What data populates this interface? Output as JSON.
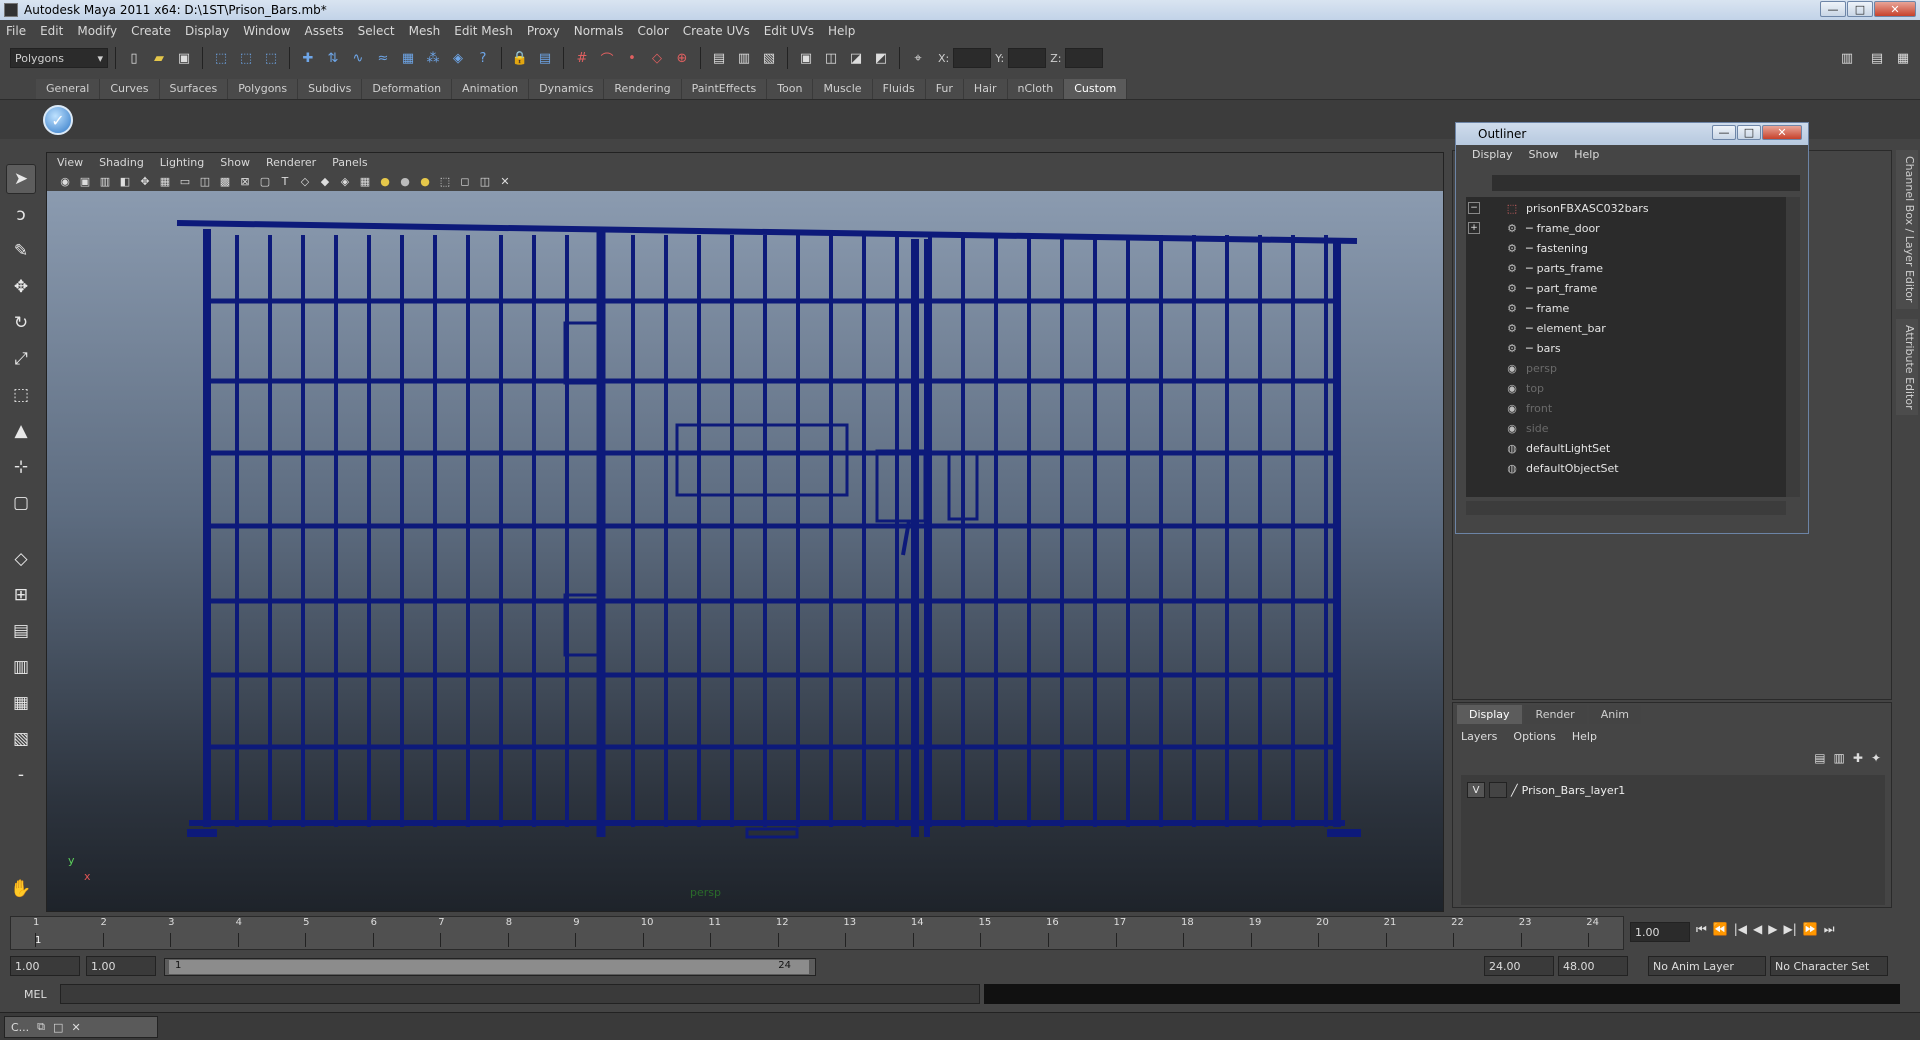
{
  "window": {
    "title": "Autodesk Maya 2011 x64: D:\\1ST\\Prison_Bars.mb*",
    "min": "—",
    "max": "□",
    "close": "✕"
  },
  "menubar": [
    "File",
    "Edit",
    "Modify",
    "Create",
    "Display",
    "Window",
    "Assets",
    "Select",
    "Mesh",
    "Edit Mesh",
    "Proxy",
    "Normals",
    "Color",
    "Create UVs",
    "Edit UVs",
    "Help"
  ],
  "status": {
    "mode": "Polygons",
    "x_label": "X:",
    "y_label": "Y:",
    "z_label": "Z:"
  },
  "shelf_tabs": [
    "General",
    "Curves",
    "Surfaces",
    "Polygons",
    "Subdivs",
    "Deformation",
    "Animation",
    "Dynamics",
    "Rendering",
    "PaintEffects",
    "Toon",
    "Muscle",
    "Fluids",
    "Fur",
    "Hair",
    "nCloth",
    "Custom"
  ],
  "shelf_active": "Custom",
  "viewport": {
    "menu": [
      "View",
      "Shading",
      "Lighting",
      "Show",
      "Renderer",
      "Panels"
    ],
    "camera_label": "persp",
    "axis_y": "y",
    "axis_x": "x",
    "wire_color": "#0d1a7a"
  },
  "outliner": {
    "title": "Outliner",
    "menu": [
      "Display",
      "Show",
      "Help"
    ],
    "items": [
      {
        "label": "prisonFBXASC032bars",
        "dim": false
      },
      {
        "label": "frame_door",
        "dim": false
      },
      {
        "label": "fastening",
        "dim": false
      },
      {
        "label": "parts_frame",
        "dim": false
      },
      {
        "label": "part_frame",
        "dim": false
      },
      {
        "label": "frame",
        "dim": false
      },
      {
        "label": "element_bar",
        "dim": false
      },
      {
        "label": "bars",
        "dim": false
      },
      {
        "label": "persp",
        "dim": true
      },
      {
        "label": "top",
        "dim": true
      },
      {
        "label": "front",
        "dim": true
      },
      {
        "label": "side",
        "dim": true
      },
      {
        "label": "defaultLightSet",
        "dim": false
      },
      {
        "label": "defaultObjectSet",
        "dim": false
      }
    ]
  },
  "side_tabs": [
    "Channel Box / Layer Editor",
    "Attribute Editor"
  ],
  "layer_editor": {
    "tabs": [
      "Display",
      "Render",
      "Anim"
    ],
    "menu": [
      "Layers",
      "Options",
      "Help"
    ],
    "layer": {
      "visible": "V",
      "name": "Prison_Bars_layer1"
    }
  },
  "timeline": {
    "ticks": [
      "1",
      "2",
      "3",
      "4",
      "5",
      "6",
      "7",
      "8",
      "9",
      "10",
      "11",
      "12",
      "13",
      "14",
      "15",
      "16",
      "17",
      "18",
      "19",
      "20",
      "21",
      "22",
      "23",
      "24"
    ],
    "current_frame": "1",
    "current_frame_field": "1.00",
    "playback": [
      "⏮",
      "⏪",
      "|◀",
      "◀",
      "▶",
      "▶|",
      "⏩",
      "⏭"
    ]
  },
  "range": {
    "start": "1.00",
    "playback_start": "1.00",
    "slider_start": "1",
    "slider_end": "24",
    "playback_end": "24.00",
    "end": "48.00",
    "anim_layer": "No Anim Layer",
    "character_set": "No Character Set"
  },
  "command": {
    "label": "MEL"
  },
  "taskbar": {
    "item": "C..."
  }
}
